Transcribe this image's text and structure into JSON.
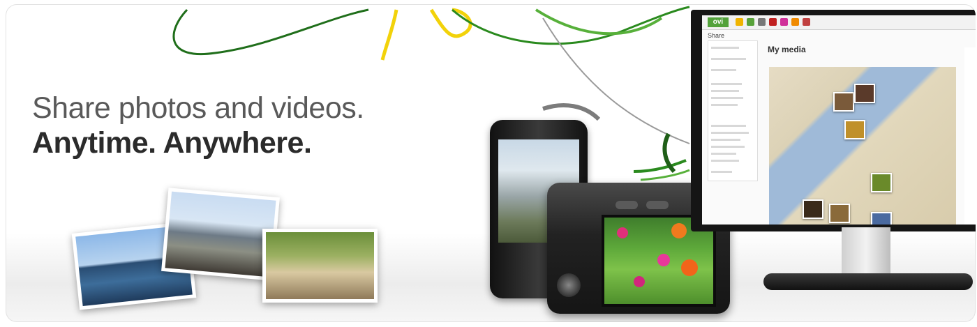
{
  "hero": {
    "line1": "Share photos and videos.",
    "line2": "Anytime. Anywhere."
  },
  "monitor_ui": {
    "logo": "ovi",
    "sidebar_title": "Share",
    "main_title": "My media"
  },
  "colors": {
    "accent_green": "#2f8f1f",
    "accent_yellow": "#f2d20a",
    "ovi_green": "#52a23a"
  }
}
